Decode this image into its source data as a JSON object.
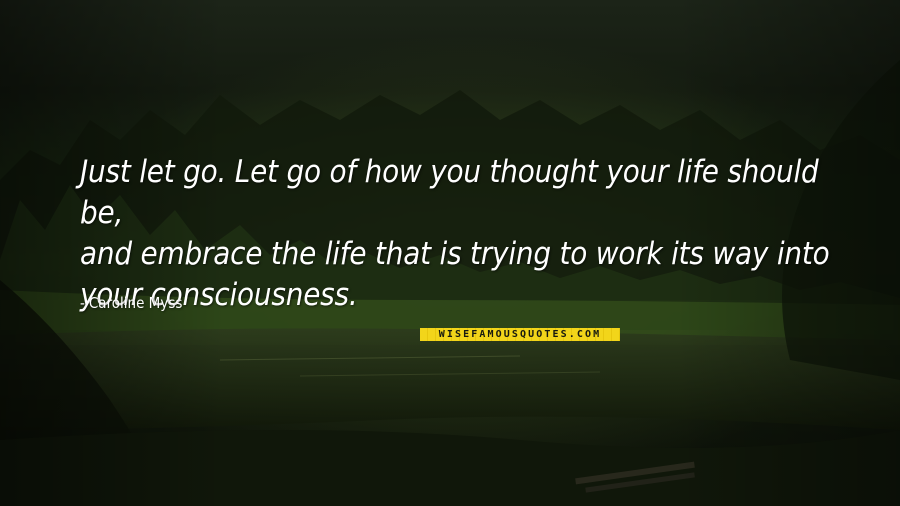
{
  "quote": {
    "line1": "Just let go. Let go of how you thought your life should be,",
    "line2": "and embrace the life that is trying to work its way into",
    "line3": "your consciousness."
  },
  "author": {
    "dash": "-",
    "name": "Caroline Myss"
  },
  "watermark": {
    "text": "WISEFAMOUSQUOTES.COM"
  },
  "colors": {
    "text": "#ffffff",
    "watermark_bg": "#f2d51a",
    "watermark_text": "#171a10"
  }
}
